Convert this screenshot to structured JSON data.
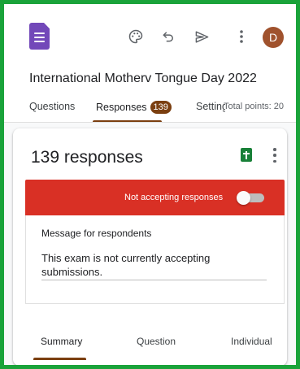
{
  "header": {
    "icons": [
      "google-forms-logo",
      "palette-icon",
      "undo-icon",
      "send-icon",
      "more-vert-icon"
    ],
    "avatar_initial": "D",
    "avatar_color": "#a0522d"
  },
  "form": {
    "title": "International Motherv Tongue  Day 2022"
  },
  "tabs": {
    "questions": "Questions",
    "responses": "Responses",
    "responses_count": "139",
    "settings": "Settings",
    "total_points": "Total points: 20"
  },
  "responses": {
    "count_label": "139 responses",
    "sheets_icon": "sheets-icon",
    "banner_text": "Not accepting responses",
    "accepting_responses": false,
    "message_label": "Message for respondents",
    "message_text": "This exam is not currently accepting submissions."
  },
  "view_tabs": {
    "summary": "Summary",
    "question": "Question",
    "individual": "Individual",
    "selected": "Summary"
  },
  "colors": {
    "frame_border": "#1aa33a",
    "accent": "#7b3f10",
    "banner": "#d93025",
    "forms_purple": "#7248b9",
    "sheets_green": "#188038"
  }
}
